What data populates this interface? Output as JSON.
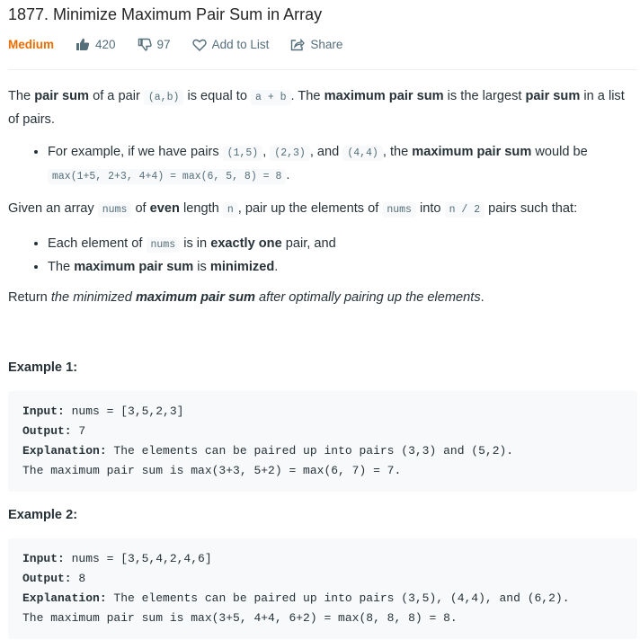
{
  "problem": {
    "title": "1877. Minimize Maximum Pair Sum in Array",
    "difficulty": "Medium",
    "likes": "420",
    "dislikes": "97",
    "add_to_list": "Add to List",
    "share": "Share"
  },
  "desc": {
    "p1": [
      "The ",
      "pair sum",
      " of a pair ",
      "(a,b)",
      " is equal to ",
      "a + b",
      ". The ",
      "maximum pair sum",
      " is the largest ",
      "pair sum",
      " in a list of pairs."
    ],
    "b1": [
      "For example, if we have pairs ",
      "(1,5)",
      ", ",
      "(2,3)",
      ", and ",
      "(4,4)",
      ", the ",
      "maximum pair sum",
      " would be ",
      "max(1+5, 2+3, 4+4) = max(6, 5, 8) = 8",
      "."
    ],
    "p2": [
      "Given an array ",
      "nums",
      " of ",
      "even",
      " length ",
      "n",
      ", pair up the elements of ",
      "nums",
      " into ",
      "n / 2",
      " pairs such that:"
    ],
    "b2": [
      "Each element of ",
      "nums",
      " is in ",
      "exactly one",
      " pair, and"
    ],
    "b3": [
      "The ",
      "maximum pair sum",
      " is ",
      "minimized",
      "."
    ],
    "p3": [
      "Return ",
      "the minimized ",
      "maximum pair sum",
      " after optimally pairing up the elements",
      "."
    ]
  },
  "examples": [
    {
      "title": "Example 1:",
      "input_label": "Input:",
      "input": " nums = [3,5,2,3]",
      "output_label": "Output:",
      "output": " 7",
      "expl_label": "Explanation:",
      "expl": " The elements can be paired up into pairs (3,3) and (5,2).",
      "expl2": "The maximum pair sum is max(3+3, 5+2) = max(6, 7) = 7."
    },
    {
      "title": "Example 2:",
      "input_label": "Input:",
      "input": " nums = [3,5,4,2,4,6]",
      "output_label": "Output:",
      "output": " 8",
      "expl_label": "Explanation:",
      "expl": " The elements can be paired up into pairs (3,5), (4,4), and (6,2).",
      "expl2": "The maximum pair sum is max(3+5, 4+4, 6+2) = max(8, 8, 8) = 8."
    }
  ],
  "colors": {
    "difficulty": "#ef6c00",
    "meta": "#546e7a",
    "code_bg": "#f7f9fa"
  },
  "icons": [
    "thumbs-up-icon",
    "thumbs-down-icon",
    "heart-icon",
    "share-icon"
  ]
}
